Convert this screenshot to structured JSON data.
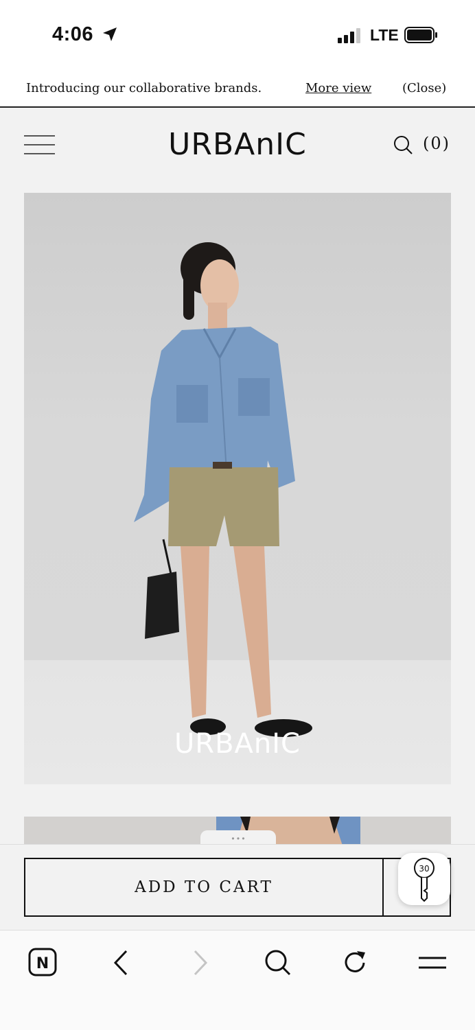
{
  "status_bar": {
    "time": "4:06",
    "network": "LTE"
  },
  "announcement": {
    "text": "Introducing our collaborative brands.",
    "more_link": "More view",
    "close_label": "(Close)"
  },
  "header": {
    "logo": "URBAnIC",
    "cart_count": "(0)"
  },
  "hero": {
    "watermark": "URBAnIC"
  },
  "bottom_sheet": {
    "handle": "• • •",
    "add_to_cart": "ADD TO CART",
    "key_badge_number": "30"
  },
  "browser_toolbar": {
    "home_icon_letter": "N"
  },
  "colors": {
    "background": "#f2f2f2",
    "text": "#111111",
    "denim": "#7a9cc4",
    "shorts": "#a59a73"
  }
}
